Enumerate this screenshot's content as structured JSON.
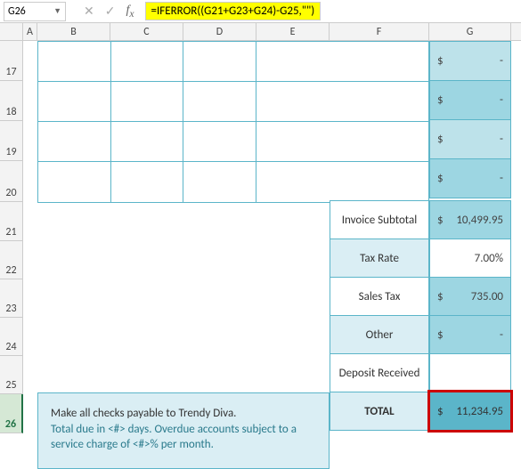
{
  "nameBox": "G26",
  "formula": "=IFERROR((G21+G23+G24)-G25,\"\")",
  "columns": [
    "A",
    "B",
    "C",
    "D",
    "E",
    "F",
    "G"
  ],
  "rows": [
    "17",
    "18",
    "19",
    "20",
    "21",
    "22",
    "23",
    "24",
    "25",
    "26"
  ],
  "activeRow": "26",
  "gTop": [
    {
      "dollar": "$",
      "val": "-"
    },
    {
      "dollar": "$",
      "val": "-"
    },
    {
      "dollar": "$",
      "val": "-"
    },
    {
      "dollar": "$",
      "val": "-"
    }
  ],
  "labels": {
    "subtotal": "Invoice Subtotal",
    "taxrate": "Tax Rate",
    "salestax": "Sales Tax",
    "other": "Other",
    "deposit": "Deposit Received",
    "total": "TOTAL"
  },
  "values": {
    "subtotal_d": "$",
    "subtotal": "10,499.95",
    "taxrate": "7.00%",
    "salestax_d": "$",
    "salestax": "735.00",
    "other_d": "$",
    "other": "-",
    "deposit": "",
    "total_d": "$",
    "total": "11,234.95"
  },
  "notes": {
    "line1": "Make all checks payable to Trendy Diva.",
    "line2": "Total due in <#> days. Overdue accounts subject to a service charge of <#>% per month."
  }
}
